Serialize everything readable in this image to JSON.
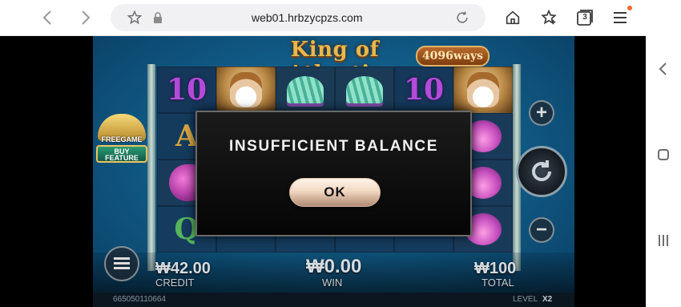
{
  "browser": {
    "url": "web01.hrbzycpzs.com",
    "tab_count": "3",
    "accent_dot_color": "#f06a2b",
    "icons": [
      "back-icon",
      "forward-icon",
      "bookmark-star-icon",
      "lock-icon",
      "reload-icon",
      "home-icon",
      "favorites-icon",
      "tabs-icon",
      "menu-icon"
    ]
  },
  "game": {
    "title": "King of Atlantis",
    "ways": "4096ways",
    "buy_feature": {
      "top": "FREEGAME",
      "line1": "BUY",
      "line2": "FEATURE"
    },
    "reels": [
      [
        "10",
        "king",
        "shell",
        "shell",
        "10",
        "king"
      ],
      [
        "A",
        "",
        "",
        "",
        "",
        "coral"
      ],
      [
        "horse",
        "",
        "",
        "",
        "",
        "coral"
      ],
      [
        "Q",
        "",
        "",
        "",
        "",
        "coral"
      ]
    ],
    "credit_value": "₩42.00",
    "credit_label": "CREDIT",
    "win_value": "₩0.00",
    "win_label": "WIN",
    "total_value": "₩100",
    "total_label": "TOTAL",
    "round_id": "665050110664",
    "level_label": "LEVEL",
    "level_value": "X2"
  },
  "modal": {
    "title": "INSUFFICIENT BALANCE",
    "ok_label": "OK"
  },
  "side_nav": [
    "back-chevron-icon",
    "home-square-icon",
    "recents-icon"
  ]
}
